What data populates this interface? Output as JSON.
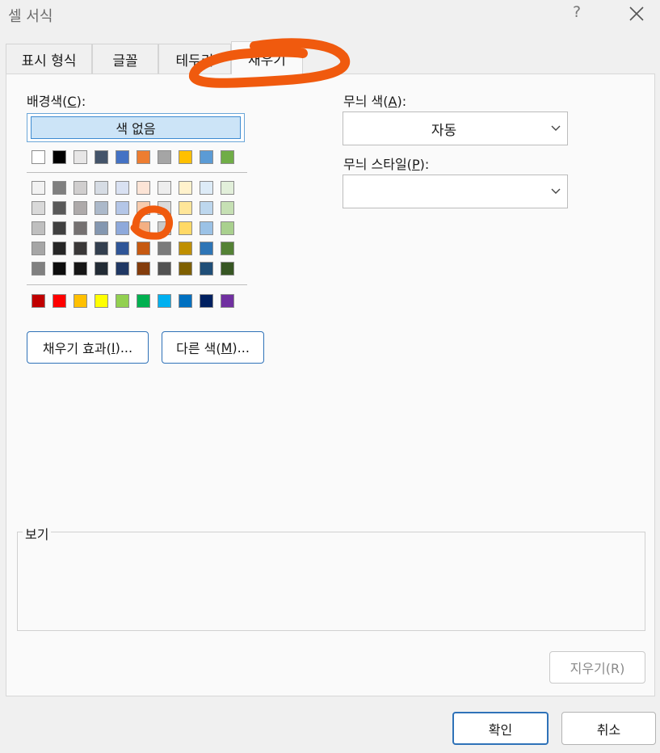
{
  "window": {
    "title": "셀 서식",
    "help": "?"
  },
  "tabs": [
    {
      "label": "표시 형식"
    },
    {
      "label": "글꼴"
    },
    {
      "label": "테두리"
    },
    {
      "label": "채우기",
      "active": true
    }
  ],
  "fill": {
    "background_label_prefix": "배경색(",
    "background_label_key": "C",
    "background_label_suffix": "):",
    "no_color": "색 없음",
    "theme_row": [
      "#ffffff",
      "#000000",
      "#e7e6e6",
      "#44546a",
      "#4472c4",
      "#ed7d31",
      "#a5a5a5",
      "#ffc000",
      "#5b9bd5",
      "#70ad47"
    ],
    "shade_rows": [
      [
        "#f2f2f2",
        "#7f7f7f",
        "#d0cece",
        "#d6dce4",
        "#d9e1f2",
        "#fce4d6",
        "#ededed",
        "#fff2cc",
        "#ddebf7",
        "#e2efda"
      ],
      [
        "#d9d9d9",
        "#595959",
        "#aeaaaa",
        "#acb9ca",
        "#b4c6e7",
        "#f8cbad",
        "#dbdbdb",
        "#ffe699",
        "#bdd7ee",
        "#c6e0b4"
      ],
      [
        "#bfbfbf",
        "#404040",
        "#757171",
        "#8497b0",
        "#8ea9db",
        "#f4b084",
        "#c9c9c9",
        "#ffd966",
        "#9bc2e6",
        "#a9d08e"
      ],
      [
        "#a6a6a6",
        "#262626",
        "#3a3838",
        "#333f4f",
        "#2f5597",
        "#c65911",
        "#7b7b7b",
        "#bf8f00",
        "#2e75b6",
        "#548235"
      ],
      [
        "#808080",
        "#0d0d0d",
        "#161616",
        "#222b35",
        "#203864",
        "#833c0c",
        "#525252",
        "#7f6000",
        "#1f4e78",
        "#375623"
      ]
    ],
    "standard_row": [
      "#c00000",
      "#ff0000",
      "#ffc000",
      "#ffff00",
      "#92d050",
      "#00b050",
      "#00b0f0",
      "#0070c0",
      "#002060",
      "#7030a0"
    ],
    "fill_effects": {
      "prefix": "채우기 효과(",
      "key": "I",
      "suffix": ")..."
    },
    "more_colors": {
      "prefix": "다른 색(",
      "key": "M",
      "suffix": ")..."
    },
    "pattern_color": {
      "prefix": "무늬 색(",
      "key": "A",
      "suffix": "):",
      "value": "자동"
    },
    "pattern_style": {
      "prefix": "무늬 스타일(",
      "key": "P",
      "suffix": "):",
      "value": ""
    },
    "sample": {
      "label": "보기"
    },
    "clear": "지우기(R)"
  },
  "footer": {
    "ok": "확인",
    "cancel": "취소"
  },
  "annotation": {
    "color": "#f05a0e"
  }
}
